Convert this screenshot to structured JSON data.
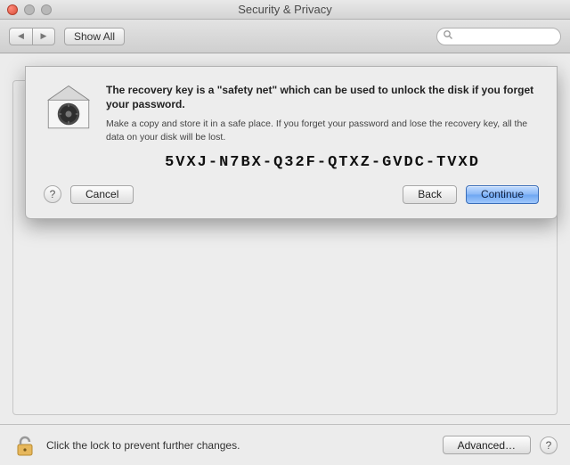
{
  "window": {
    "title": "Security & Privacy"
  },
  "toolbar": {
    "show_all_label": "Show All",
    "search_placeholder": ""
  },
  "sheet": {
    "heading": "The recovery key is a \"safety net\" which can be used to unlock the disk if you forget your password.",
    "sub": "Make a copy and store it in a safe place. If you forget your password and lose the recovery key, all the data on your disk will be lost.",
    "recovery_key": "5VXJ-N7BX-Q32F-QTXZ-GVDC-TVXD",
    "cancel_label": "Cancel",
    "back_label": "Back",
    "continue_label": "Continue"
  },
  "footer": {
    "lock_text": "Click the lock to prevent further changes.",
    "advanced_label": "Advanced…"
  }
}
